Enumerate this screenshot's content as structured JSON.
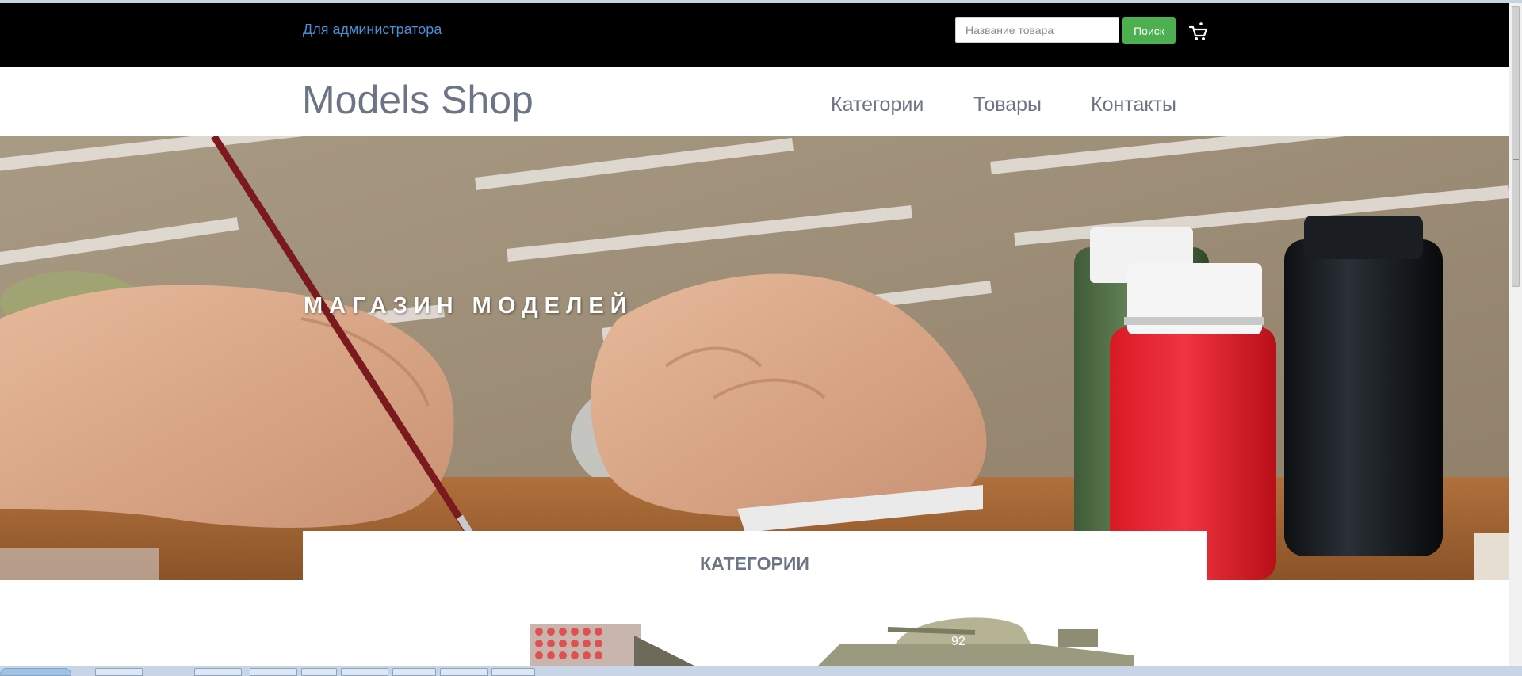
{
  "topbar": {
    "admin_link": "Для администратора",
    "search_placeholder": "Название товара",
    "search_button": "Поиск",
    "cart_icon": "cart-icon"
  },
  "header": {
    "logo": "Models Shop",
    "nav": [
      "Категории",
      "Товары",
      "Контакты"
    ]
  },
  "hero": {
    "title": "МАГАЗИН МОДЕЛЕЙ"
  },
  "categories": {
    "title": "КАТЕГОРИИ"
  },
  "colors": {
    "topbar_bg": "#000000",
    "link": "#4a8fd4",
    "search_button": "#4caf50",
    "text_muted": "#6b7585"
  }
}
